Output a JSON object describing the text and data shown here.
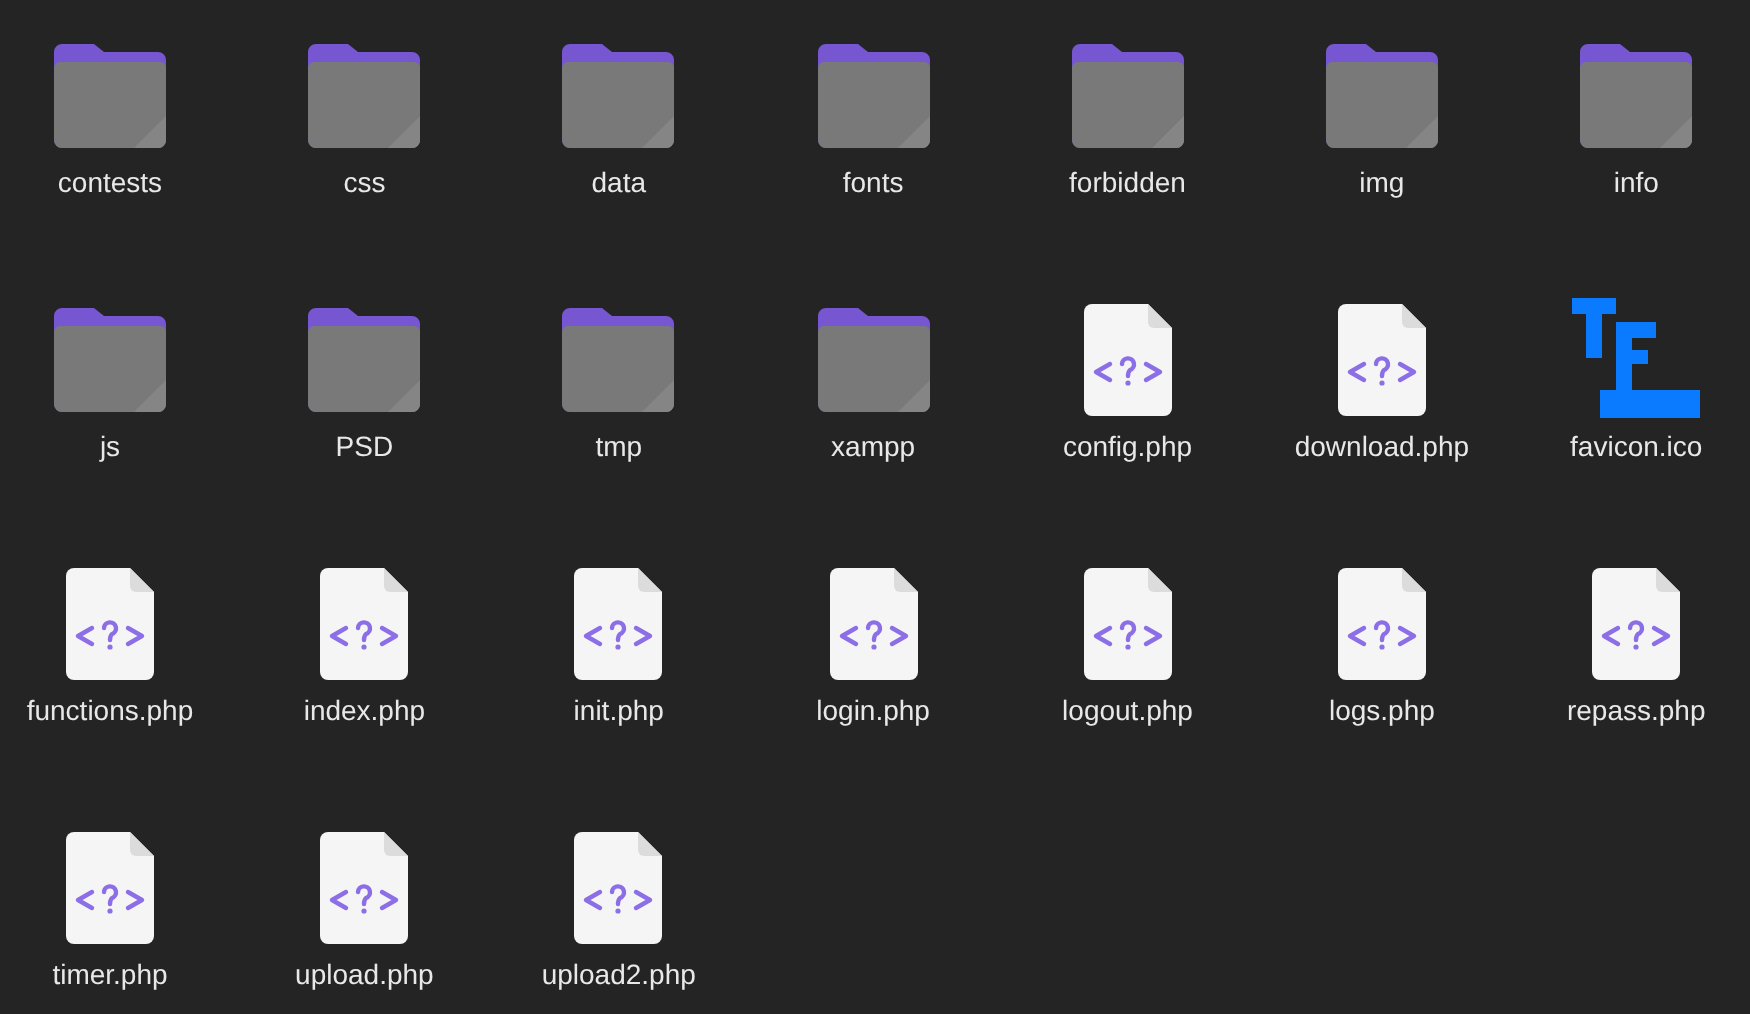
{
  "files": [
    {
      "name": "contests",
      "kind": "folder"
    },
    {
      "name": "css",
      "kind": "folder"
    },
    {
      "name": "data",
      "kind": "folder"
    },
    {
      "name": "fonts",
      "kind": "folder"
    },
    {
      "name": "forbidden",
      "kind": "folder"
    },
    {
      "name": "img",
      "kind": "folder"
    },
    {
      "name": "info",
      "kind": "folder"
    },
    {
      "name": "js",
      "kind": "folder"
    },
    {
      "name": "PSD",
      "kind": "folder"
    },
    {
      "name": "tmp",
      "kind": "folder"
    },
    {
      "name": "xampp",
      "kind": "folder"
    },
    {
      "name": "config.php",
      "kind": "php"
    },
    {
      "name": "download.php",
      "kind": "php"
    },
    {
      "name": "favicon.ico",
      "kind": "image"
    },
    {
      "name": "functions.php",
      "kind": "php"
    },
    {
      "name": "index.php",
      "kind": "php"
    },
    {
      "name": "init.php",
      "kind": "php"
    },
    {
      "name": "login.php",
      "kind": "php"
    },
    {
      "name": "logout.php",
      "kind": "php"
    },
    {
      "name": "logs.php",
      "kind": "php"
    },
    {
      "name": "repass.php",
      "kind": "php"
    },
    {
      "name": "timer.php",
      "kind": "php"
    },
    {
      "name": "upload.php",
      "kind": "php"
    },
    {
      "name": "upload2.php",
      "kind": "php"
    }
  ]
}
